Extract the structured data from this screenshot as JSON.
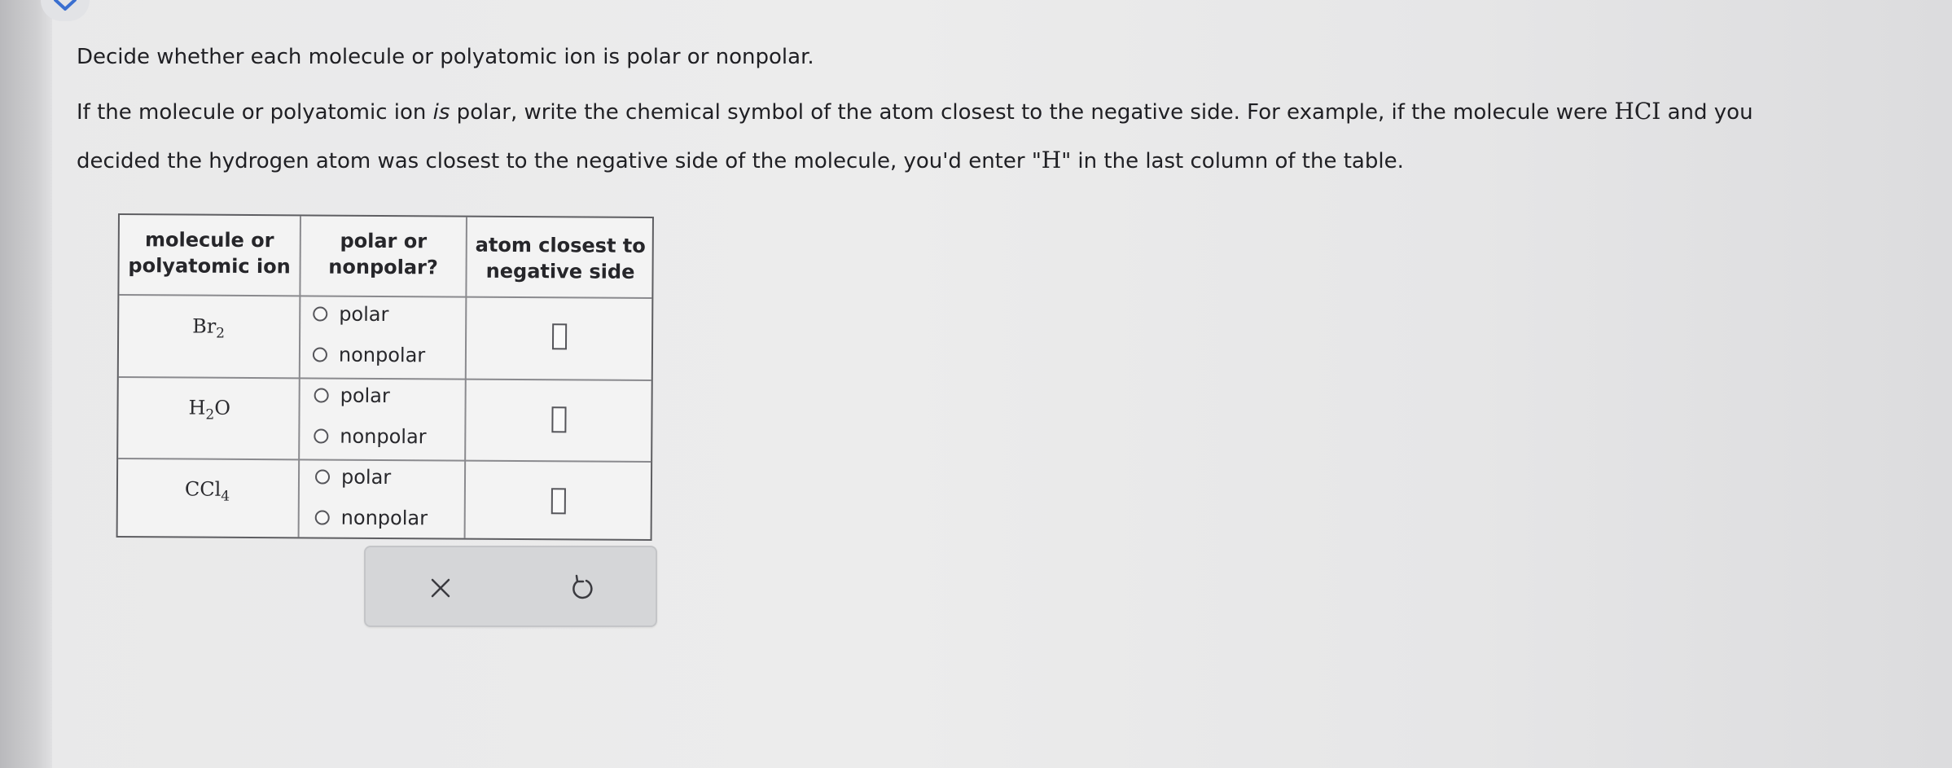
{
  "instructions": {
    "line1": "Decide whether each molecule or polyatomic ion is polar or nonpolar.",
    "line2": {
      "a": "If the molecule or polyatomic ion ",
      "b": "is",
      "c": " polar, write the chemical symbol of the atom closest to the negative side. For example, if the molecule were ",
      "d": "HCI",
      "e": " and you"
    },
    "line3": {
      "a": "decided the hydrogen atom was closest to the negative side of the molecule, you'd enter \"",
      "b": "H",
      "c": "\" in the last column of the table."
    }
  },
  "table": {
    "headers": {
      "col1_line1": "molecule or",
      "col1_line2": "polyatomic ion",
      "col2_line1": "polar or",
      "col2_line2": "nonpolar?",
      "col3_line1": "atom closest to",
      "col3_line2": "negative side"
    },
    "rows": [
      {
        "formula_main": "Br",
        "formula_sub": "2",
        "formula_tail": "",
        "option_polar": "polar",
        "option_nonpolar": "nonpolar",
        "answer": ""
      },
      {
        "formula_main": "H",
        "formula_sub": "2",
        "formula_tail": "O",
        "option_polar": "polar",
        "option_nonpolar": "nonpolar",
        "answer": ""
      },
      {
        "formula_main": "CCl",
        "formula_sub": "4",
        "formula_tail": "",
        "option_polar": "polar",
        "option_nonpolar": "nonpolar",
        "answer": ""
      }
    ]
  },
  "actions": {
    "clear_icon": "x-icon",
    "undo_icon": "undo-icon"
  },
  "colors": {
    "table_border": "#5e5e62",
    "action_bar": "#d5d6d8",
    "background": "#ececec"
  }
}
